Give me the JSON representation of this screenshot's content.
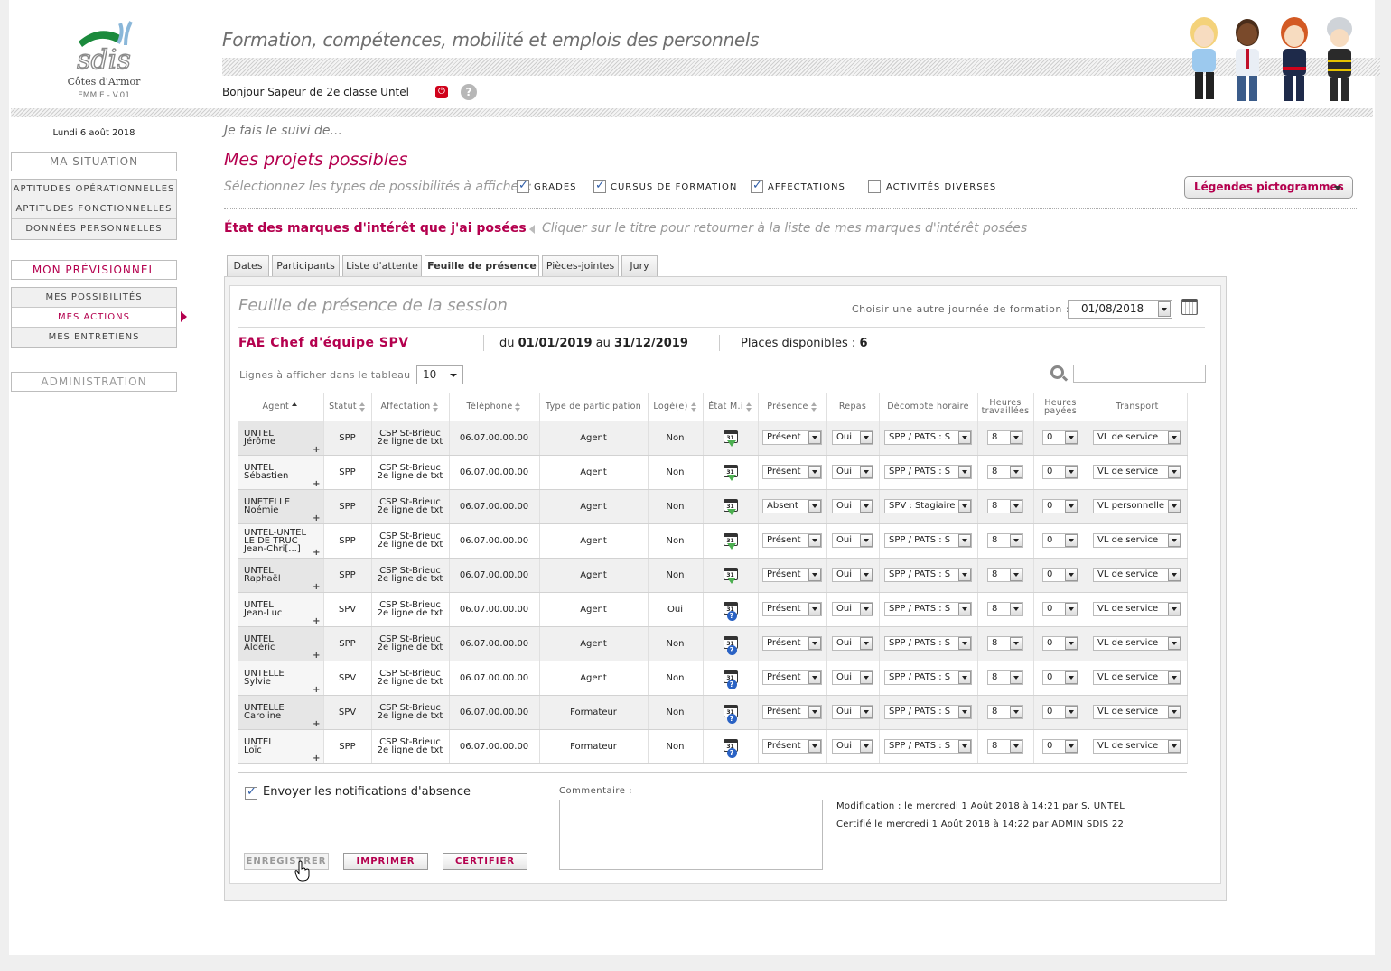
{
  "app": {
    "logo_text": "sdis",
    "department": "Côtes d'Armor",
    "version": "EMMIE - V.01",
    "tagline": "Formation, compétences, mobilité et emplois des personnels",
    "greeting": "Bonjour Sapeur de 2e classe Untel"
  },
  "sidebar": {
    "date": "Lundi 6 août 2018",
    "ma_situation": "MA SITUATION",
    "situation_items": [
      "APTITUDES OPÉRATIONNELLES",
      "APTITUDES FONCTIONNELLES",
      "DONNÉES PERSONNELLES"
    ],
    "mon_previsionnel": "MON PRÉVISIONNEL",
    "previsionnel_items": [
      "MES POSSIBILITÉS",
      "MES ACTIONS",
      "MES ENTRETIENS"
    ],
    "administration": "ADMINISTRATION"
  },
  "main": {
    "subtitle": "Je fais le suivi de...",
    "title": "Mes projets possibles",
    "select_types": "Sélectionnez les types de possibilités à afficher :",
    "filters": [
      {
        "label": "GRADES",
        "checked": true
      },
      {
        "label": "CURSUS DE FORMATION",
        "checked": true
      },
      {
        "label": "AFFECTATIONS",
        "checked": true
      },
      {
        "label": "ACTIVITÉS DIVERSES",
        "checked": false
      }
    ],
    "legend_button": "Légendes pictogrammes",
    "etat_title": "État des marques d'intérêt que j'ai posées",
    "etat_hint": "Cliquer sur le titre pour retourner à la liste de mes marques d'intérêt posées"
  },
  "tabs": [
    "Dates",
    "Participants",
    "Liste d'attente",
    "Feuille de présence",
    "Pièces-jointes",
    "Jury"
  ],
  "active_tab": "Feuille de présence",
  "sheet": {
    "title": "Feuille de présence de la session",
    "choose_label": "Choisir une autre journée de formation :",
    "choose_date": "01/08/2018",
    "session_name": "FAE Chef d'équipe SPV",
    "du": "du",
    "date_start": "01/01/2019",
    "au": "au",
    "date_end": "31/12/2019",
    "places_label": "Places disponibles :",
    "places_value": "6",
    "lines_label": "Lignes à afficher dans le tableau",
    "lines_value": "10",
    "columns": [
      "Agent",
      "Statut",
      "Affectation",
      "Téléphone",
      "Type de participation",
      "Logé(e)",
      "État M.i",
      "Présence",
      "Repas",
      "Décompte horaire",
      "Heures travaillées",
      "Heures payées",
      "Transport"
    ],
    "rows": [
      {
        "name": [
          "UNTEL",
          "Jérôme"
        ],
        "statut": "SPP",
        "aff": [
          "CSP St-Brieuc",
          "2e ligne de txt"
        ],
        "tel": "06.07.00.00.00",
        "type": "Agent",
        "loge": "Non",
        "etat": "ok",
        "presence": "Présent",
        "repas": "Oui",
        "decompte": "SPP / PATS : S",
        "ht": "8",
        "hp": "0",
        "transport": "VL de service"
      },
      {
        "name": [
          "UNTEL",
          "Sébastien"
        ],
        "statut": "SPP",
        "aff": [
          "CSP St-Brieuc",
          "2e ligne de txt"
        ],
        "tel": "06.07.00.00.00",
        "type": "Agent",
        "loge": "Non",
        "etat": "ok",
        "presence": "Présent",
        "repas": "Oui",
        "decompte": "SPP / PATS : S",
        "ht": "8",
        "hp": "0",
        "transport": "VL de service"
      },
      {
        "name": [
          "UNETELLE",
          "Noémie"
        ],
        "statut": "SPP",
        "aff": [
          "CSP St-Brieuc",
          "2e ligne de txt"
        ],
        "tel": "06.07.00.00.00",
        "type": "Agent",
        "loge": "Non",
        "etat": "ok",
        "presence": "Absent",
        "repas": "Oui",
        "decompte": "SPV : Stagiaire",
        "ht": "8",
        "hp": "0",
        "transport": "VL personnelle"
      },
      {
        "name": [
          "UNTEL-UNTEL",
          "LE DE TRUC",
          "Jean-Chri[...]"
        ],
        "statut": "SPP",
        "aff": [
          "CSP St-Brieuc",
          "2e ligne de txt"
        ],
        "tel": "06.07.00.00.00",
        "type": "Agent",
        "loge": "Non",
        "etat": "ok",
        "presence": "Présent",
        "repas": "Oui",
        "decompte": "SPP / PATS : S",
        "ht": "8",
        "hp": "0",
        "transport": "VL de service"
      },
      {
        "name": [
          "UNTEL",
          "Raphaël"
        ],
        "statut": "SPP",
        "aff": [
          "CSP St-Brieuc",
          "2e ligne de txt"
        ],
        "tel": "06.07.00.00.00",
        "type": "Agent",
        "loge": "Non",
        "etat": "ok",
        "presence": "Présent",
        "repas": "Oui",
        "decompte": "SPP / PATS : S",
        "ht": "8",
        "hp": "0",
        "transport": "VL de service"
      },
      {
        "name": [
          "UNTEL",
          "Jean-Luc"
        ],
        "statut": "SPV",
        "aff": [
          "CSP St-Brieuc",
          "2e ligne de txt"
        ],
        "tel": "06.07.00.00.00",
        "type": "Agent",
        "loge": "Oui",
        "etat": "q",
        "presence": "Présent",
        "repas": "Oui",
        "decompte": "SPP / PATS : S",
        "ht": "8",
        "hp": "0",
        "transport": "VL de service"
      },
      {
        "name": [
          "UNTEL",
          "Aldéric"
        ],
        "statut": "SPP",
        "aff": [
          "CSP St-Brieuc",
          "2e ligne de txt"
        ],
        "tel": "06.07.00.00.00",
        "type": "Agent",
        "loge": "Non",
        "etat": "q",
        "presence": "Présent",
        "repas": "Oui",
        "decompte": "SPP / PATS : S",
        "ht": "8",
        "hp": "0",
        "transport": "VL de service"
      },
      {
        "name": [
          "UNTELLE",
          "Sylvie"
        ],
        "statut": "SPV",
        "aff": [
          "CSP St-Brieuc",
          "2e ligne de txt"
        ],
        "tel": "06.07.00.00.00",
        "type": "Agent",
        "loge": "Non",
        "etat": "q",
        "presence": "Présent",
        "repas": "Oui",
        "decompte": "SPP / PATS : S",
        "ht": "8",
        "hp": "0",
        "transport": "VL de service"
      },
      {
        "name": [
          "UNTELLE",
          "Caroline"
        ],
        "statut": "SPV",
        "aff": [
          "CSP St-Brieuc",
          "2e ligne de txt"
        ],
        "tel": "06.07.00.00.00",
        "type": "Formateur",
        "loge": "Non",
        "etat": "q",
        "presence": "Présent",
        "repas": "Oui",
        "decompte": "SPP / PATS : S",
        "ht": "8",
        "hp": "0",
        "transport": "VL de service"
      },
      {
        "name": [
          "UNTEL",
          "Loïc"
        ],
        "statut": "SPP",
        "aff": [
          "CSP St-Brieuc",
          "2e ligne de txt"
        ],
        "tel": "06.07.00.00.00",
        "type": "Formateur",
        "loge": "Non",
        "etat": "q",
        "presence": "Présent",
        "repas": "Oui",
        "decompte": "SPP / PATS : S",
        "ht": "8",
        "hp": "0",
        "transport": "VL de service"
      }
    ],
    "calendar_day": "31",
    "notif_label": "Envoyer les notifications d'absence",
    "notif_checked": true,
    "comment_label": "Commentaire :",
    "modification": "Modification : le mercredi 1 Août 2018 à 14:21 par S. UNTEL",
    "certification": "Certifié le mercredi 1 Août 2018 à 14:22 par ADMIN SDIS 22",
    "buttons": {
      "save": "ENREGISTRER",
      "print": "IMPRIMER",
      "certify": "CERTIFIER"
    }
  },
  "colors": {
    "accent": "#b4004e",
    "ok": "#4caf50",
    "info": "#2a62c4"
  }
}
